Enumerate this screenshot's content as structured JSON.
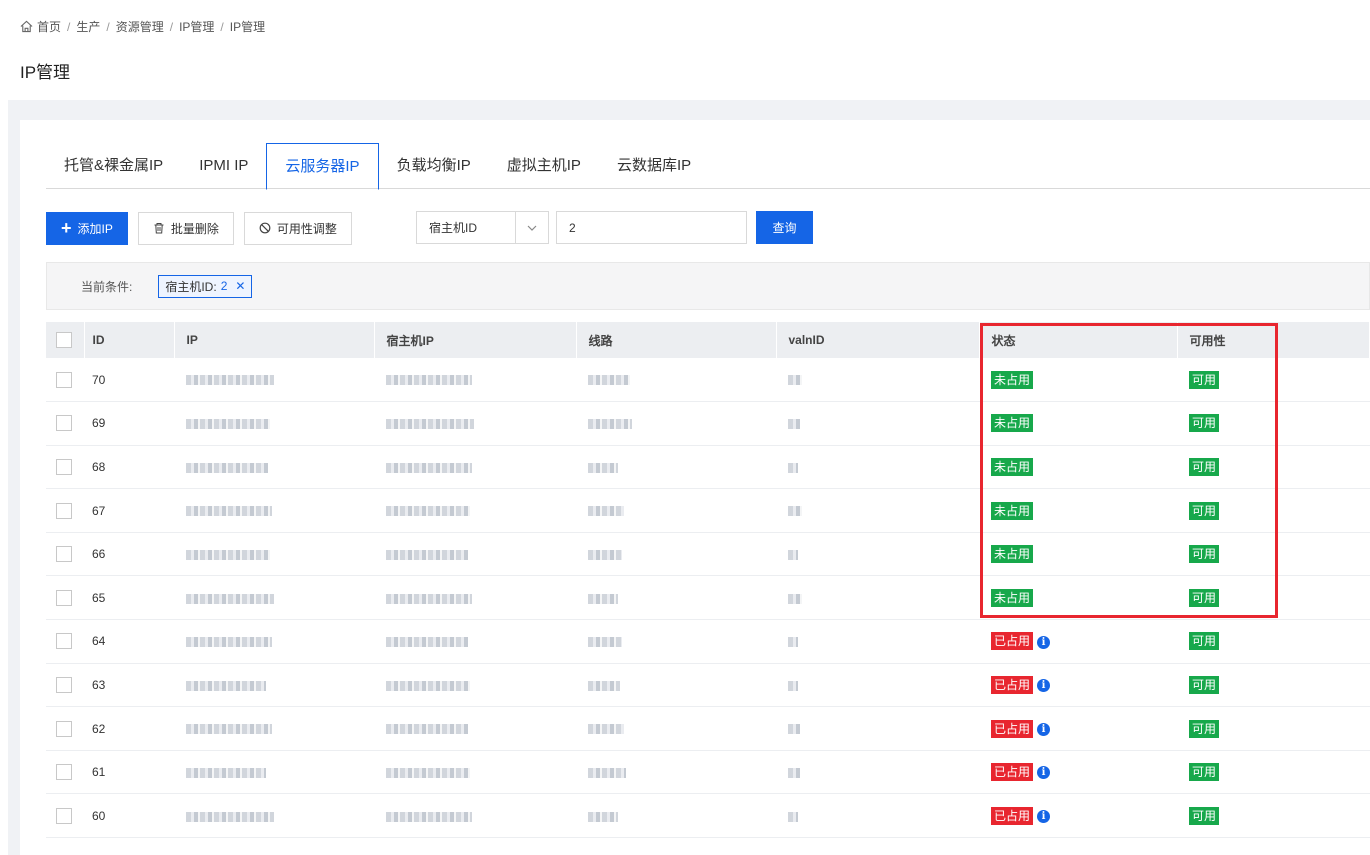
{
  "breadcrumb": {
    "items": [
      "首页",
      "生产",
      "资源管理",
      "IP管理",
      "IP管理"
    ]
  },
  "page_title": "IP管理",
  "tabs": [
    {
      "label": "托管&裸金属IP",
      "active": false
    },
    {
      "label": "IPMI IP",
      "active": false
    },
    {
      "label": "云服务器IP",
      "active": true
    },
    {
      "label": "负载均衡IP",
      "active": false
    },
    {
      "label": "虚拟主机IP",
      "active": false
    },
    {
      "label": "云数据库IP",
      "active": false
    }
  ],
  "toolbar": {
    "add_label": "添加IP",
    "batch_delete_label": "批量删除",
    "availability_label": "可用性调整"
  },
  "search": {
    "field_selected": "宿主机ID",
    "value": "2",
    "query_label": "查询"
  },
  "conditions": {
    "label": "当前条件:",
    "tag_label": "宿主机ID:",
    "tag_value": "2"
  },
  "table": {
    "columns": [
      "ID",
      "IP",
      "宿主机IP",
      "线路",
      "valnID",
      "状态",
      "可用性"
    ],
    "rows": [
      {
        "id": "70",
        "status": "未占用",
        "status_type": "free",
        "availability": "可用"
      },
      {
        "id": "69",
        "status": "未占用",
        "status_type": "free",
        "availability": "可用"
      },
      {
        "id": "68",
        "status": "未占用",
        "status_type": "free",
        "availability": "可用"
      },
      {
        "id": "67",
        "status": "未占用",
        "status_type": "free",
        "availability": "可用"
      },
      {
        "id": "66",
        "status": "未占用",
        "status_type": "free",
        "availability": "可用"
      },
      {
        "id": "65",
        "status": "未占用",
        "status_type": "free",
        "availability": "可用"
      },
      {
        "id": "64",
        "status": "已占用",
        "status_type": "used",
        "availability": "可用"
      },
      {
        "id": "63",
        "status": "已占用",
        "status_type": "used",
        "availability": "可用"
      },
      {
        "id": "62",
        "status": "已占用",
        "status_type": "used",
        "availability": "可用"
      },
      {
        "id": "61",
        "status": "已占用",
        "status_type": "used",
        "availability": "可用"
      },
      {
        "id": "60",
        "status": "已占用",
        "status_type": "used",
        "availability": "可用"
      }
    ]
  },
  "colors": {
    "primary": "#1565e6",
    "free_badge": "#17a84b",
    "used_badge": "#e8262f",
    "highlight": "#e8262f"
  },
  "icons": {
    "home": "home-icon",
    "add": "plus-icon",
    "delete": "trash-icon",
    "availability": "ban-icon",
    "dropdown": "chevron-down-icon",
    "close": "close-icon",
    "info": "info-icon"
  }
}
